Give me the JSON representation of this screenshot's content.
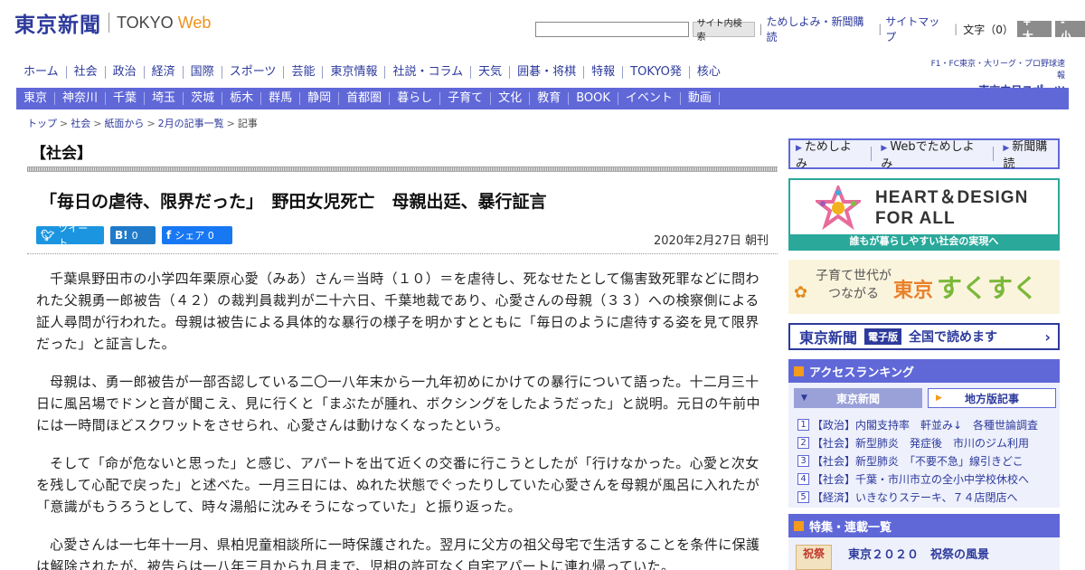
{
  "header": {
    "logo_jp": "東京新聞",
    "logo_en": "TOKYO",
    "logo_web": "Web",
    "search_button": "サイト内検索",
    "links": [
      "ためしよみ・新聞購読",
      "サイトマップ"
    ],
    "font_size_label": "文字（0）",
    "font_up": "+ 大",
    "font_down": "- 小"
  },
  "main_nav": [
    "ホーム",
    "社会",
    "政治",
    "経済",
    "国際",
    "スポーツ",
    "芸能",
    "東京情報",
    "社説・コラム",
    "天気",
    "囲碁・将棋",
    "特報",
    "TOKYO発",
    "核心"
  ],
  "chunichi": {
    "top": "F1・FC東京・大リーグ・プロ野球速報",
    "logo": "▸ 東京中日スポーツ"
  },
  "region_nav": [
    "東京",
    "神奈川",
    "千葉",
    "埼玉",
    "茨城",
    "栃木",
    "群馬",
    "静岡",
    "首都圏",
    "暮らし",
    "子育て",
    "文化",
    "教育",
    "BOOK",
    "イベント",
    "動画"
  ],
  "breadcrumb": {
    "items": [
      "トップ",
      "社会",
      "紙面から",
      "2月の記事一覧"
    ],
    "current": "記事",
    "sep": ">"
  },
  "article": {
    "section": "【社会】",
    "headline": "「毎日の虐待、限界だった」　野田女児死亡　母親出廷、暴行証言",
    "date": "2020年2月27日 朝刊",
    "paragraphs": [
      "千葉県野田市の小学四年栗原心愛（みあ）さん＝当時（１０）＝を虐待し、死なせたとして傷害致死罪などに問われた父親勇一郎被告（４２）の裁判員裁判が二十六日、千葉地裁であり、心愛さんの母親（３３）への検察側による証人尋問が行われた。母親は被告による具体的な暴行の様子を明かすとともに「毎日のように虐待する姿を見て限界だった」と証言した。",
      "母親は、勇一郎被告が一部否認している二〇一八年末から一九年初めにかけての暴行について語った。十二月三十日に風呂場でドンと音が聞こえ、見に行くと「まぶたが腫れ、ボクシングをしたようだった」と説明。元日の午前中には一時間ほどスクワットをさせられ、心愛さんは動けなくなったという。",
      "そして「命が危ないと思った」と感じ、アパートを出て近くの交番に行こうとしたが「行けなかった。心愛と次女を残して心配で戻った」と述べた。一月三日には、ぬれた状態でぐったりしていた心愛さんを母親が風呂に入れたが「意識がもうろうとして、時々湯船に沈みそうになっていた」と振り返った。",
      "心愛さんは一七年十一月、県柏児童相談所に一時保護された。翌月に父方の祖父母宅で生活することを条件に保護は解除されたが、被告らは一八年三月から九月まで、児相の許可なく自宅アパートに連れ帰っていた。"
    ]
  },
  "social": {
    "tweet": "ツイート",
    "hatena": "0",
    "share": "シェア 0"
  },
  "sidebar": {
    "tabs": [
      "ためしよみ",
      "Webでためしよみ",
      "新聞購読"
    ],
    "heart": {
      "line1": "HEART＆DESIGN",
      "line2": "FOR ALL",
      "sub": "誰もが暮らしやすい社会の実現へ"
    },
    "sukusuku": {
      "small1": "子育て世代が",
      "small2": "つながる",
      "tokyo": "東京",
      "big": "すくすく"
    },
    "epaper": {
      "logo": "東京新聞",
      "badge": "電子版",
      "text": "全国で読めます"
    },
    "ranking": {
      "title": "アクセスランキング",
      "tab_active": "東京新聞",
      "tab_inactive": "地方版記事",
      "items": [
        "【政治】内閣支持率　軒並み↓　各種世論調査",
        "【社会】新型肺炎　発症後　市川のジム利用",
        "【社会】新型肺炎　「不要不急」線引きどこ",
        "【社会】千葉・市川市立の全小中学校休校へ",
        "【経済】いきなりステーキ、７４店閉店へ"
      ]
    },
    "feature": {
      "title": "特集・連載一覧",
      "item": "東京２０２０　祝祭の風景",
      "thumb": "祝祭"
    }
  }
}
